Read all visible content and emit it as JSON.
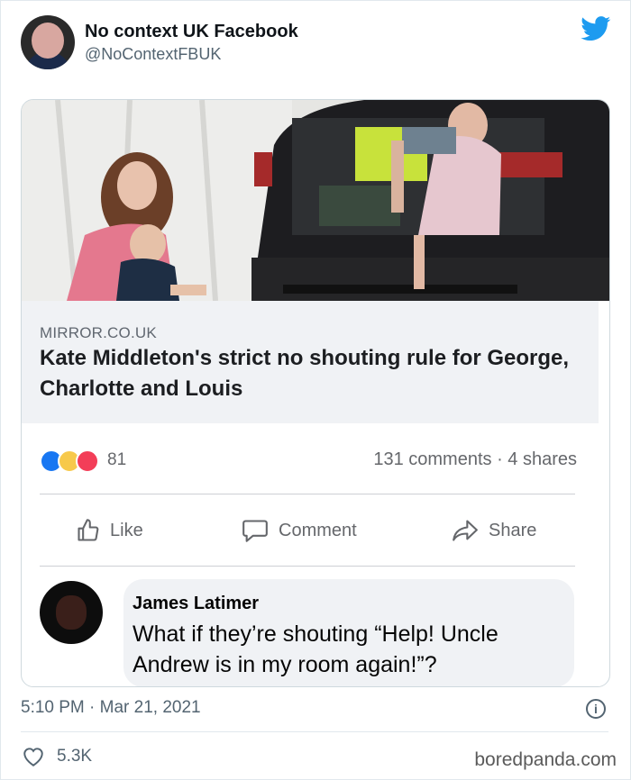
{
  "tweet": {
    "author_name": "No context UK Facebook",
    "author_handle": "@NoContextFBUK",
    "timestamp": "5:10 PM · Mar 21, 2021",
    "likes": "5.3K",
    "avatar_icon": "person-avatar-icon",
    "twitter_icon": "twitter-bird-icon",
    "brand_color": "#1d9bf0"
  },
  "facebook_post": {
    "link": {
      "domain": "MIRROR.CO.UK",
      "title": "Kate Middleton's strict no shouting rule for George, Charlotte and Louis"
    },
    "reaction_count": "81",
    "stats": "131 comments · 4 shares",
    "actions": {
      "like": "Like",
      "comment": "Comment",
      "share": "Share"
    },
    "comment": {
      "name": "James Latimer",
      "text": "What if they’re shouting “Help! Uncle Andrew is in my room again!”?"
    }
  },
  "watermark": "boredpanda.com"
}
